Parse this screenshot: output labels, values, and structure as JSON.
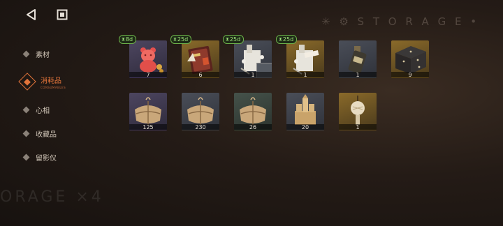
{
  "background": {
    "watermark_top": "✳ ⚙ S T O R A G E •",
    "watermark_bottom": "ORAGE ×4"
  },
  "nav": {
    "back_icon": "back-triangle-icon",
    "home_icon": "square-stop-icon"
  },
  "sidebar": {
    "items": [
      {
        "label": "素材",
        "active": false
      },
      {
        "label": "消耗品",
        "sub": "CONSUMABLES",
        "active": true
      },
      {
        "label": "心相",
        "active": false
      },
      {
        "label": "收藏品",
        "active": false
      },
      {
        "label": "留影仪",
        "active": false
      }
    ]
  },
  "inventory": {
    "row1": [
      {
        "count": "7",
        "timer": "8d",
        "rarity": "purple",
        "icon": "gummy-bear-icon"
      },
      {
        "count": "6",
        "timer": "25d",
        "rarity": "gold",
        "icon": "book-bundle-icon"
      },
      {
        "count": "1",
        "timer": "25d",
        "rarity": "grey",
        "icon": "ticket-bundle-icon"
      },
      {
        "count": "1",
        "timer": "25d",
        "rarity": "gold",
        "icon": "ticket-bundle-icon"
      },
      {
        "count": "1",
        "rarity": "grey",
        "icon": "bottle-icon"
      },
      {
        "count": "9",
        "rarity": "gold",
        "icon": "gift-box-icon"
      }
    ],
    "row2": [
      {
        "count": "125",
        "rarity": "purple",
        "icon": "cloth-bundle-icon"
      },
      {
        "count": "230",
        "rarity": "grey",
        "icon": "cloth-bundle-icon"
      },
      {
        "count": "26",
        "rarity": "green",
        "icon": "cloth-bundle-icon"
      },
      {
        "count": "20",
        "rarity": "grey",
        "icon": "sand-castle-icon"
      },
      {
        "count": "1",
        "rarity": "gold",
        "icon": "tassel-ornament-icon"
      }
    ]
  }
}
